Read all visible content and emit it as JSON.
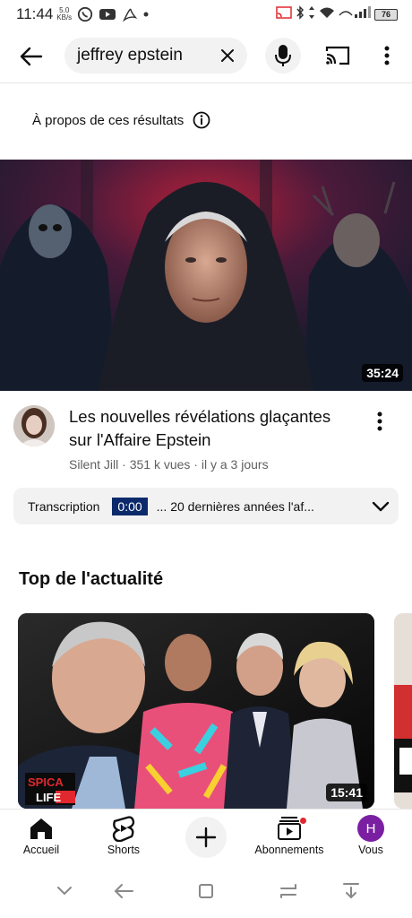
{
  "status_bar": {
    "time": "11:44",
    "speed_value": "5.0",
    "speed_unit": "KB/s",
    "battery": "76"
  },
  "search": {
    "query": "jeffrey epstein"
  },
  "about_results": {
    "label": "À propos de ces résultats"
  },
  "video": {
    "duration": "35:24",
    "title": "Les nouvelles révélations glaçantes sur l'Affaire Epstein",
    "channel": "Silent Jill",
    "views": "351 k vues",
    "age": "il y a 3 jours",
    "meta_separator": " · "
  },
  "transcript": {
    "label": "Transcription",
    "timestamp": "0:00",
    "snippet": "... 20 dernières années l'af..."
  },
  "top_news": {
    "title": "Top de l'actualité",
    "card_duration": "15:41",
    "card_logo_top": "SPICA",
    "card_logo_bottom": "LIFE"
  },
  "bottom_nav": {
    "items": [
      {
        "label": "Accueil",
        "icon": "home-icon"
      },
      {
        "label": "Shorts",
        "icon": "shorts-icon"
      },
      {
        "label": "",
        "icon": "add-icon"
      },
      {
        "label": "Abonnements",
        "icon": "subscriptions-icon"
      },
      {
        "label": "Vous",
        "icon": "avatar"
      }
    ],
    "avatar_letter": "H"
  },
  "colors": {
    "accent_red": "#e0282e",
    "timestamp_bg": "#0c2a6b",
    "avatar_purple": "#7b1fa2"
  }
}
